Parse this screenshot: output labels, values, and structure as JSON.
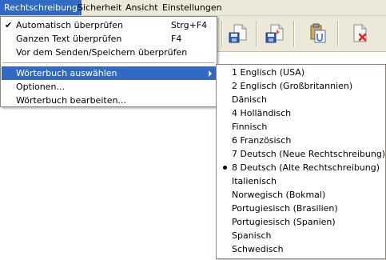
{
  "menubar": {
    "items": [
      {
        "label": "Rechtschreibung",
        "active": true
      },
      {
        "label": "Sicherheit"
      },
      {
        "label": "Ansicht"
      },
      {
        "label": "Einstellungen"
      }
    ]
  },
  "toolbar": {
    "buttons": [
      {
        "icon": "save-document-icon"
      },
      {
        "icon": "send-document-icon"
      },
      {
        "icon": "clipboard-copy-icon"
      },
      {
        "icon": "delete-document-icon"
      }
    ]
  },
  "menu": {
    "items": [
      {
        "label": "Automatisch überprüfen",
        "shortcut": "Strg+F4",
        "checked": true,
        "check_glyph": "✔"
      },
      {
        "label": "Ganzen Text überprüfen",
        "shortcut": "F4"
      },
      {
        "label": "Vor dem Senden/Speichern überprüfen"
      },
      {
        "label": "Wörterbuch auswählen",
        "highlighted": true,
        "submenu": true
      },
      {
        "label": "Optionen..."
      },
      {
        "label": "Wörterbuch bearbeiten..."
      }
    ]
  },
  "submenu": {
    "selected": "8 Deutsch (Alte Rechtschreibung)",
    "items": [
      "1 Englisch (USA)",
      "2 Englisch (Großbritannien)",
      "Dänisch",
      "4 Holländisch",
      "Finnisch",
      "6 Französisch",
      "7 Deutsch (Neue Rechtschreibung)",
      "8 Deutsch (Alte Rechtschreibung)",
      "Italienisch",
      "Norwegisch (Bokmal)",
      "Portugiesisch (Brasilien)",
      "Portugiesisch (Spanien)",
      "Spanisch",
      "Schwedisch"
    ]
  },
  "colors": {
    "highlight": "#316ac5",
    "menubar_bg": "#ece9d8"
  }
}
